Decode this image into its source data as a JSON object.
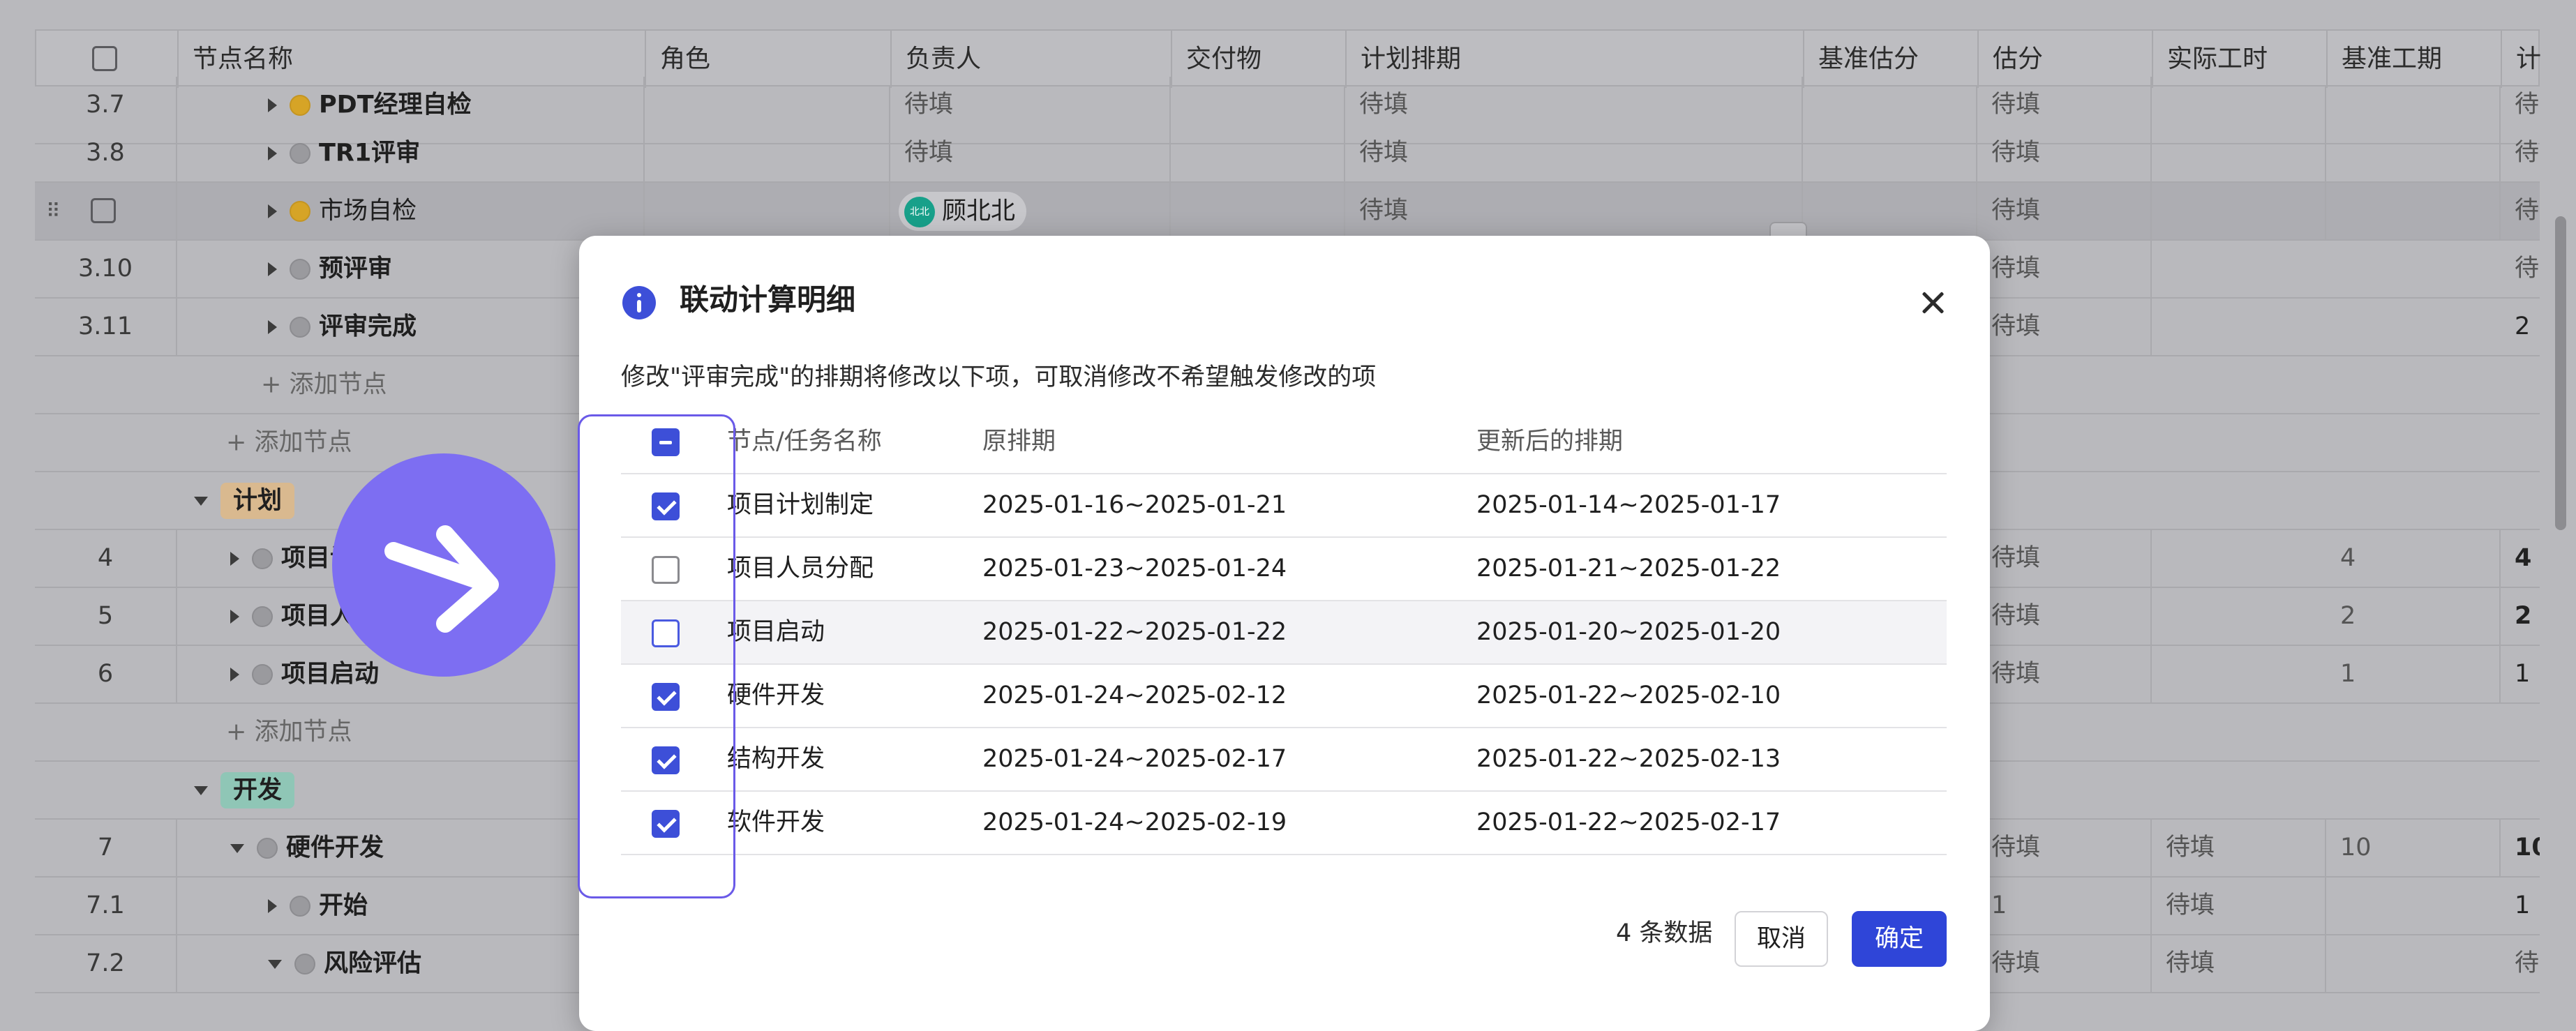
{
  "table": {
    "columns": [
      "节点名称",
      "角色",
      "负责人",
      "交付物",
      "计划排期",
      "基准估分",
      "估分",
      "实际工时",
      "基准工期",
      "计"
    ],
    "pending": "待填",
    "add_node": "添加节点",
    "rows": [
      {
        "num": "3.7",
        "name": "PDT经理自检",
        "status": "yellow",
        "owner": "待填",
        "plan": "待填",
        "est": "待填",
        "base_dur": "",
        "plan2": "待"
      },
      {
        "num": "3.8",
        "name": "TR1评审",
        "status": "gray",
        "owner": "待填",
        "plan": "待填",
        "est": "待填",
        "base_dur": "",
        "plan2": "待"
      },
      {
        "num": "",
        "name": "市场自检",
        "status": "yellow",
        "owner": "顾北北",
        "owner_avatar": "北北",
        "plan": "待填",
        "est": "待填",
        "base_dur": "",
        "plan2": "待"
      },
      {
        "num": "3.10",
        "name": "预评审",
        "status": "gray",
        "owner": "",
        "plan": "",
        "est": "待填",
        "base_dur": "",
        "plan2": "待"
      },
      {
        "num": "3.11",
        "name": "评审完成",
        "status": "gray",
        "owner": "",
        "plan": "",
        "est": "待填",
        "base_dur": "",
        "plan2": "2"
      },
      {
        "num": "4",
        "name": "项目计划",
        "status": "gray",
        "est": "待填",
        "base_dur": "4",
        "plan2": "4"
      },
      {
        "num": "5",
        "name": "项目人员",
        "status": "gray",
        "est": "待填",
        "base_dur": "2",
        "plan2": "2"
      },
      {
        "num": "6",
        "name": "项目启动",
        "status": "gray",
        "est": "待填",
        "base_dur": "1",
        "plan2": "1"
      },
      {
        "num": "7",
        "name": "硬件开发",
        "status": "gray",
        "est": "待填",
        "actual": "待填",
        "base_dur": "10",
        "plan2": "10"
      },
      {
        "num": "7.1",
        "name": "开始",
        "status": "gray",
        "est": "1",
        "actual": "待填",
        "base_dur": "",
        "plan2": "1"
      },
      {
        "num": "7.2",
        "name": "风险评估",
        "status": "gray",
        "est": "待填",
        "actual": "待填",
        "base_dur": "",
        "plan2": "待"
      }
    ],
    "groups": {
      "plan": "计划",
      "dev": "开发"
    }
  },
  "dialog": {
    "title": "联动计算明细",
    "description": "修改\"评审完成\"的排期将修改以下项，可取消修改不希望触发修改的项",
    "headers": {
      "name": "节点/任务名称",
      "original": "原排期",
      "updated": "更新后的排期"
    },
    "items": [
      {
        "name": "项目计划制定",
        "original": "2025-01-16~2025-01-21",
        "updated": "2025-01-14~2025-01-17",
        "checked": true
      },
      {
        "name": "项目人员分配",
        "original": "2025-01-23~2025-01-24",
        "updated": "2025-01-21~2025-01-22",
        "checked": false
      },
      {
        "name": "项目启动",
        "original": "2025-01-22~2025-01-22",
        "updated": "2025-01-20~2025-01-20",
        "checked": false
      },
      {
        "name": "硬件开发",
        "original": "2025-01-24~2025-02-12",
        "updated": "2025-01-22~2025-02-10",
        "checked": true
      },
      {
        "name": "结构开发",
        "original": "2025-01-24~2025-02-17",
        "updated": "2025-01-22~2025-02-13",
        "checked": true
      },
      {
        "name": "软件开发",
        "original": "2025-01-24~2025-02-19",
        "updated": "2025-01-22~2025-02-17",
        "checked": true
      }
    ],
    "count_text": "4 条数据",
    "cancel": "取消",
    "ok": "确定"
  },
  "colors": {
    "accent": "#3d4fd8",
    "cursor": "#7d6ef2",
    "overlay": "#b9b9bd"
  }
}
